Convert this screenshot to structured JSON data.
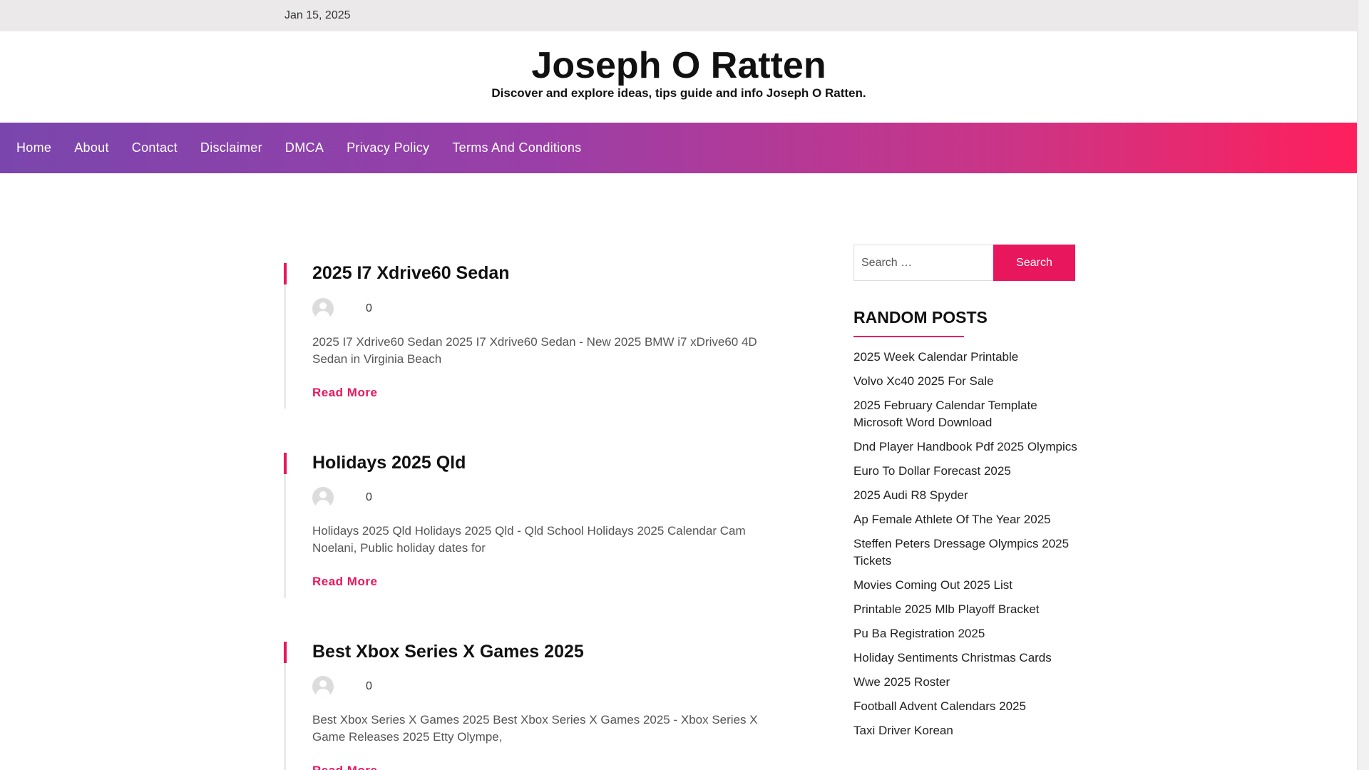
{
  "topbar": {
    "date": "Jan 15, 2025"
  },
  "site": {
    "title": "Joseph O Ratten",
    "tagline": "Discover and explore ideas, tips guide and info Joseph O Ratten."
  },
  "nav": {
    "items": [
      "Home",
      "About",
      "Contact",
      "Disclaimer",
      "DMCA",
      "Privacy Policy",
      "Terms And Conditions"
    ]
  },
  "posts": [
    {
      "title": "2025 I7 Xdrive60 Sedan",
      "comments": "0",
      "excerpt": "2025 I7 Xdrive60 Sedan 2025 I7 Xdrive60 Sedan - New 2025 BMW i7 xDrive60 4D Sedan in Virginia Beach",
      "read_more": "Read More"
    },
    {
      "title": "Holidays 2025 Qld",
      "comments": "0",
      "excerpt": "Holidays 2025 Qld Holidays 2025 Qld - Qld School Holidays 2025 Calendar Cam Noelani, Public holiday dates for",
      "read_more": "Read More"
    },
    {
      "title": "Best Xbox Series X Games 2025",
      "comments": "0",
      "excerpt": "Best Xbox Series X Games 2025 Best Xbox Series X Games 2025 - Xbox Series X Game Releases 2025 Etty Olympe,",
      "read_more": "Read More"
    }
  ],
  "sidebar": {
    "search": {
      "placeholder": "Search …",
      "button": "Search"
    },
    "random_title": "RANDOM POSTS",
    "random_posts": [
      "2025 Week Calendar Printable",
      "Volvo Xc40 2025 For Sale",
      "2025 February Calendar Template Microsoft Word Download",
      "Dnd Player Handbook Pdf 2025 Olympics",
      "Euro To Dollar Forecast 2025",
      "2025 Audi R8 Spyder",
      "Ap Female Athlete Of The Year 2025",
      "Steffen Peters Dressage Olympics 2025 Tickets",
      "Movies Coming Out 2025 List",
      "Printable 2025 Mlb Playoff Bracket",
      "Pu Ba Registration 2025",
      "Holiday Sentiments Christmas Cards",
      "Wwe 2025 Roster",
      "Football Advent Calendars 2025",
      "Taxi Driver Korean"
    ]
  },
  "colors": {
    "accent": "#e8175d",
    "nav_start": "#7a46ad",
    "nav_end": "#ff1f5c"
  }
}
